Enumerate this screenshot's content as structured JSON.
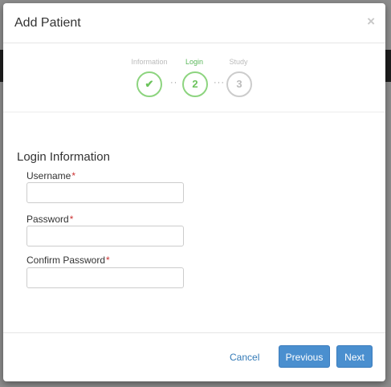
{
  "modal": {
    "title": "Add Patient",
    "close_label": "×"
  },
  "wizard": {
    "steps": [
      {
        "label": "Information",
        "indicator": "✔",
        "state": "done"
      },
      {
        "label": "Login",
        "indicator": "2",
        "state": "active"
      },
      {
        "label": "Study",
        "indicator": "3",
        "state": "pending"
      }
    ],
    "separator_1": "··",
    "separator_2": "···"
  },
  "form": {
    "section_title": "Login Information",
    "required_mark": "*",
    "username": {
      "label": "Username",
      "value": "",
      "placeholder": ""
    },
    "password": {
      "label": "Password",
      "value": "",
      "placeholder": ""
    },
    "confirm_password": {
      "label": "Confirm Password",
      "value": "",
      "placeholder": ""
    }
  },
  "footer": {
    "cancel_label": "Cancel",
    "previous_label": "Previous",
    "next_label": "Next"
  },
  "colors": {
    "accent_green": "#8dd47f",
    "primary_blue": "#4a8fcf",
    "required_red": "#cc3333"
  }
}
